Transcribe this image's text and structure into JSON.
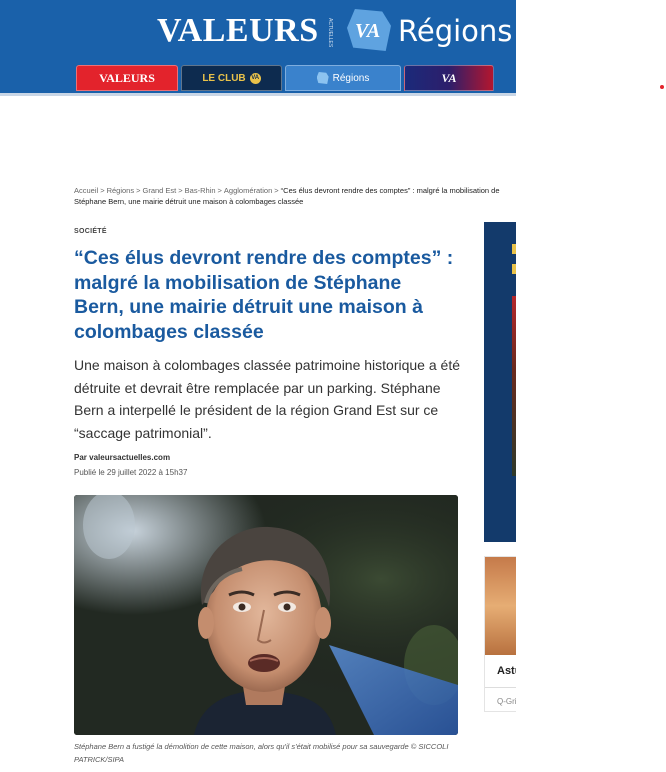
{
  "header": {
    "brand": "VALEURS",
    "brand_sub": "ACTUELLES",
    "va_logo": "VA",
    "regions_title": "Régions",
    "tabs": [
      {
        "label": "VALEURS"
      },
      {
        "label": "LE CLUB",
        "badge": "VA"
      },
      {
        "label": "Régions"
      },
      {
        "label": "VA"
      }
    ]
  },
  "breadcrumb": {
    "items": [
      "Accueil",
      "Régions",
      "Grand Est",
      "Bas-Rhin",
      "Agglomération"
    ],
    "separator": ">",
    "current": "“Ces élus devront rendre des comptes” : malgré la mobilisation de Stéphane Bern, une mairie détruit une maison à colombages classée"
  },
  "article": {
    "category": "SOCIÉTÉ",
    "title": "“Ces élus devront rendre des comptes” : malgré la mobilisation de Stéphane Bern, une mairie détruit une maison à colombages classée",
    "lead": "Une maison à colombages classée patrimoine historique a été détruite et devrait être remplacée par un parking. Stéphane Bern a interpellé le président de la région Grand Est sur ce “saccage patrimonial”.",
    "byline": "Par valeursactuelles.com",
    "date": "Publié le 29 juillet 2022 à 15h37",
    "caption": "Stéphane Bern a fustigé la démolition de cette maison, alors qu'il s'était mobilisé pour sa sauvegarde © SICCOLI PATRICK/SIPA"
  },
  "sidebar": {
    "card_title": "Astu",
    "card_source": "Q-Gri"
  },
  "colors": {
    "header_blue": "#1a61aa",
    "title_blue": "#1a5a9f",
    "red": "#e3232c",
    "club_gold": "#e9c24a"
  }
}
